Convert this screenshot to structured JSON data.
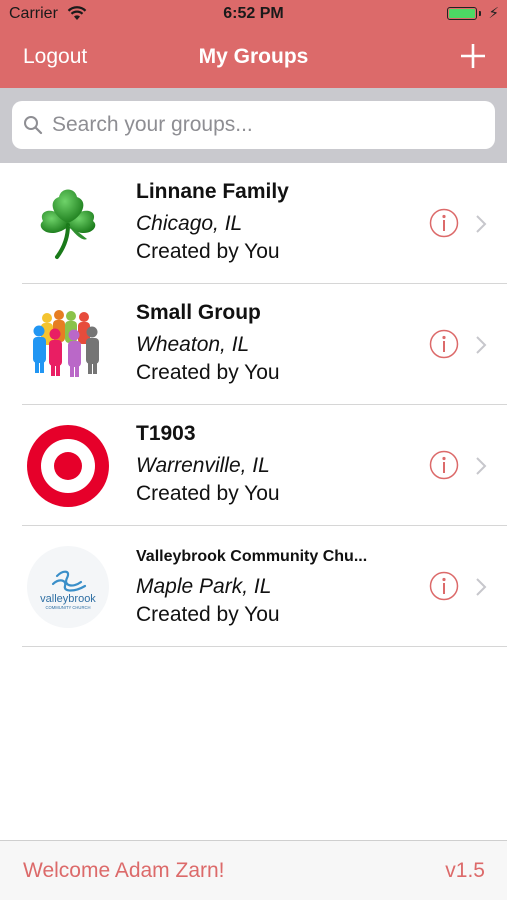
{
  "status_bar": {
    "carrier": "Carrier",
    "time": "6:52 PM"
  },
  "nav": {
    "left_label": "Logout",
    "title": "My Groups",
    "right_icon": "plus-icon"
  },
  "search": {
    "placeholder": "Search your groups..."
  },
  "groups": [
    {
      "name": "Linnane Family",
      "location": "Chicago, IL",
      "owner": "Created by You",
      "image": "shamrock-icon"
    },
    {
      "name": "Small Group",
      "location": "Wheaton, IL",
      "owner": "Created by You",
      "image": "people-group-icon"
    },
    {
      "name": "T1903",
      "location": "Warrenville, IL",
      "owner": "Created by You",
      "image": "target-logo-icon"
    },
    {
      "name": "Valleybrook Community Chu...",
      "location": "Maple Park, IL",
      "owner": "Created by You",
      "image": "valleybrook-logo",
      "logo_text": {
        "line1": "valleybrook",
        "line2": "COMMUNITY CHURCH"
      }
    }
  ],
  "footer": {
    "welcome": "Welcome Adam Zarn!",
    "version": "v1.5"
  },
  "colors": {
    "accent": "#dc6a6a",
    "search_bar_bg": "#c9c9ce",
    "battery": "#4cd964"
  }
}
